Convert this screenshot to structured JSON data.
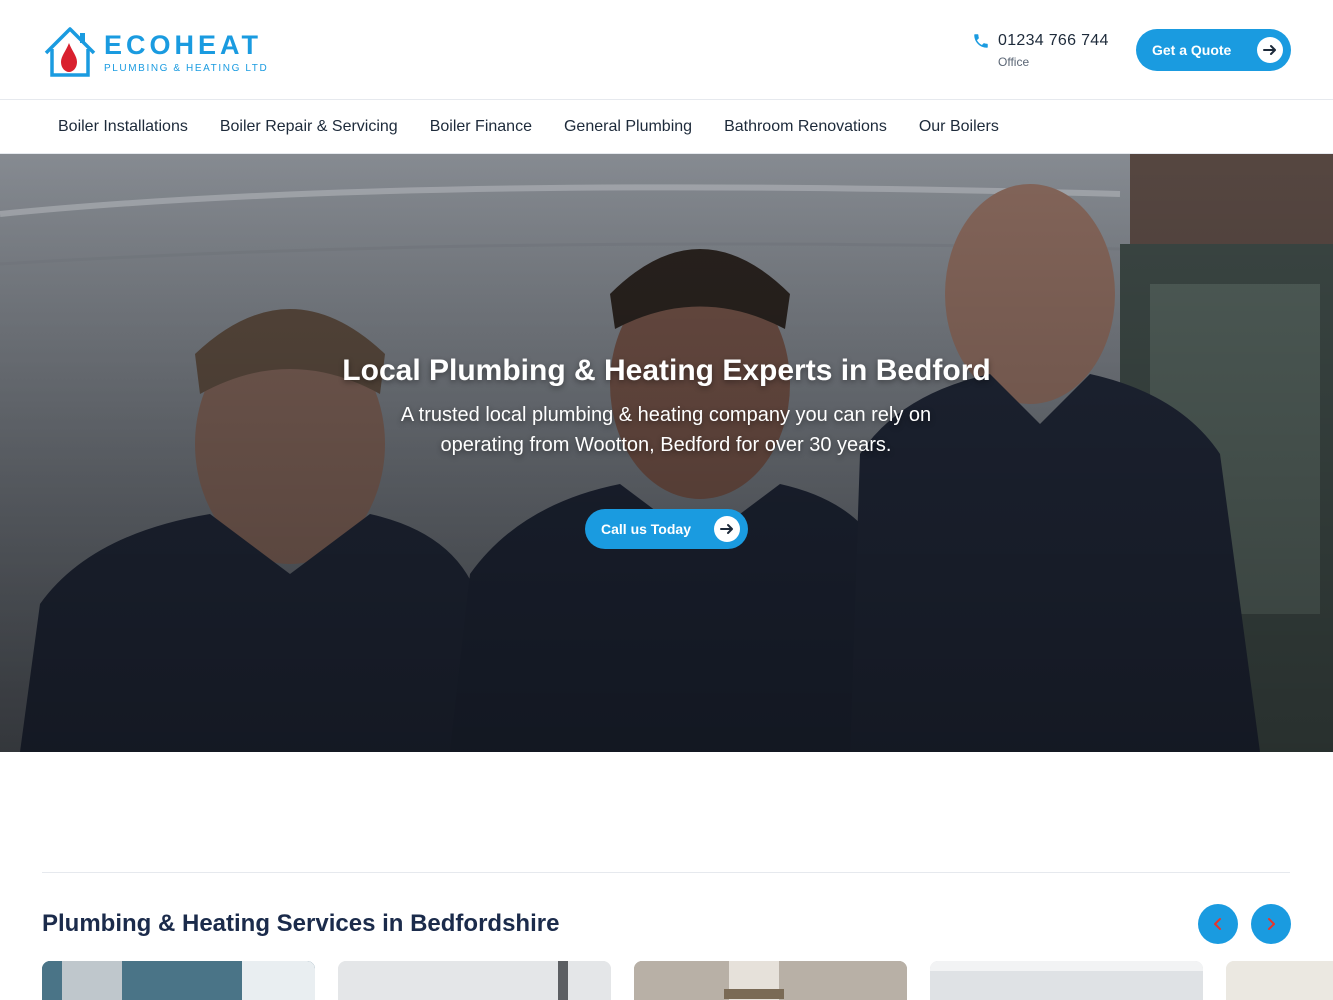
{
  "header": {
    "logo": {
      "name": "ECOHEAT",
      "tagline": "PLUMBING & HEATING LTD"
    },
    "phone": {
      "number": "01234 766 744",
      "label": "Office",
      "icon": "phone-icon"
    },
    "cta": {
      "label": "Get a Quote",
      "icon": "arrow-right-icon"
    }
  },
  "nav": {
    "items": [
      {
        "label": "Boiler Installations"
      },
      {
        "label": "Boiler Repair & Servicing"
      },
      {
        "label": "Boiler Finance"
      },
      {
        "label": "General Plumbing"
      },
      {
        "label": "Bathroom Renovations"
      },
      {
        "label": "Our Boilers"
      }
    ]
  },
  "hero": {
    "title": "Local Plumbing & Heating Experts in Bedford",
    "subtitle": "A trusted local plumbing & heating company you can rely on operating from Wootton, Bedford for over 30 years.",
    "cta": {
      "label": "Call us Today",
      "icon": "arrow-right-icon"
    }
  },
  "services": {
    "title": "Plumbing & Heating Services in Bedfordshire",
    "prev_icon": "chevron-left-icon",
    "next_icon": "chevron-right-icon"
  },
  "colors": {
    "accent": "#1a9be0",
    "heading": "#1b2b4b",
    "text": "#1d2a3a",
    "slider_arrow": "#e8352b"
  }
}
